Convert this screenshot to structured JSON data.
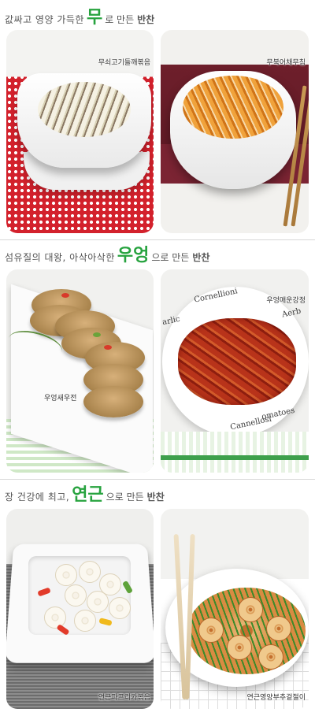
{
  "sections": [
    {
      "title_prefix": "값싸고 영양 가득한",
      "title_key": "무",
      "title_middle": "로 만든",
      "title_suffix": "반찬",
      "left_caption": "무쇠고기들깨볶음",
      "right_caption": "무북어채무침"
    },
    {
      "title_prefix": "섬유질의 대왕, 아삭아삭한",
      "title_key": "우엉",
      "title_middle": "으로 만든",
      "title_suffix": "반찬",
      "left_caption": "우엉새우전",
      "right_caption": "우엉매운강정"
    },
    {
      "title_prefix": "장 건강에 최고,",
      "title_key": "연근",
      "title_middle": "으로 만든",
      "title_suffix": "반찬",
      "left_caption": "연근파프리카볶음",
      "right_caption": "연근영양부추겉절이"
    }
  ],
  "plate_print": {
    "words": [
      "Cornellioni",
      "arlic",
      "omatoes",
      "Cannellosi",
      "Aerb"
    ]
  },
  "colors": {
    "accent_green": "#27a33f",
    "text_gray": "#555555"
  }
}
